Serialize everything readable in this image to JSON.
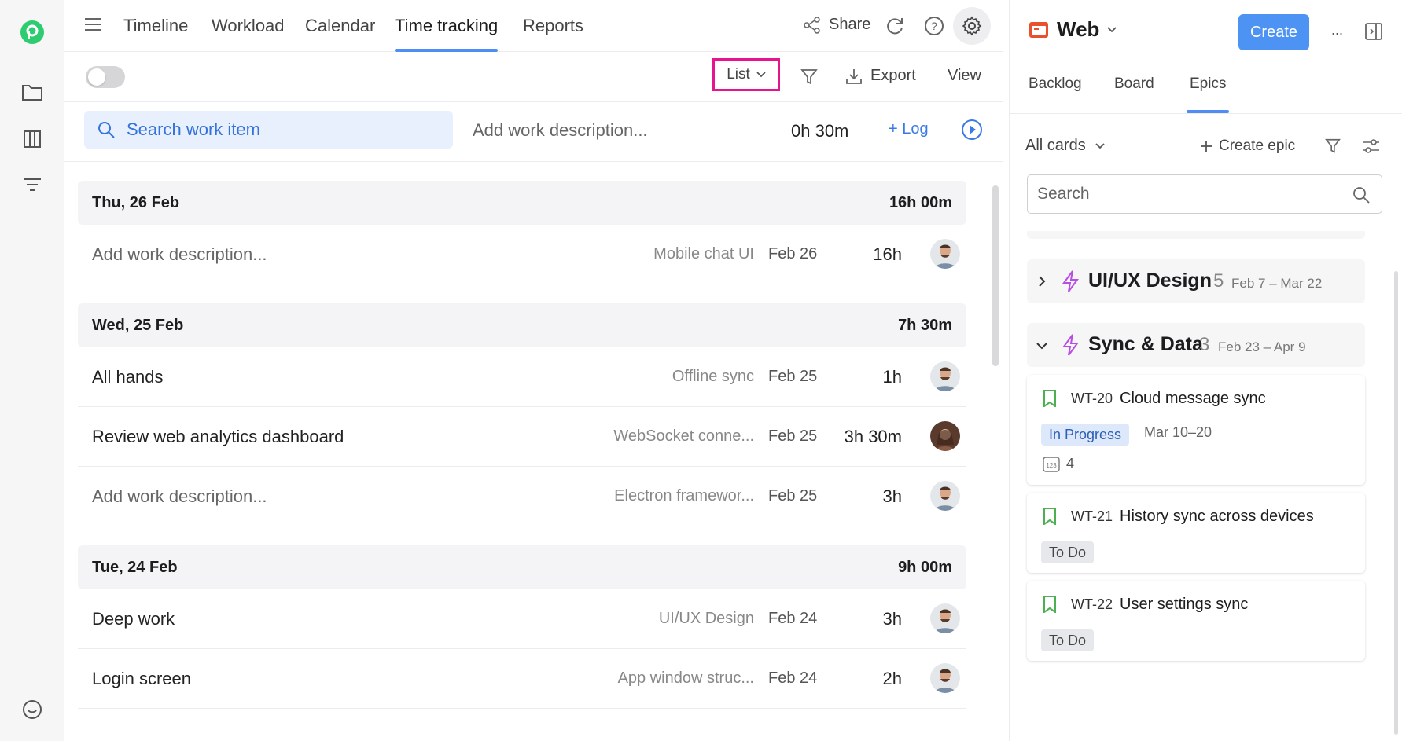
{
  "nav": {
    "tabs": [
      {
        "label": "Timeline"
      },
      {
        "label": "Workload"
      },
      {
        "label": "Calendar"
      },
      {
        "label": "Time tracking"
      },
      {
        "label": "Reports"
      }
    ],
    "share_label": "Share"
  },
  "toolbar": {
    "view_mode": "List",
    "export_label": "Export",
    "view_label": "View"
  },
  "timer": {
    "search_placeholder": "Search work item",
    "description_placeholder": "Add work description...",
    "duration": "0h 30m",
    "log_label": "+ Log"
  },
  "days": [
    {
      "date": "Thu, 26 Feb",
      "total": "16h 00m",
      "entries": [
        {
          "title": "Add work description...",
          "placeholder": true,
          "epic": "Mobile chat UI",
          "date": "Feb 26",
          "hours": "16h",
          "avatar": "man"
        }
      ]
    },
    {
      "date": "Wed, 25 Feb",
      "total": "7h 30m",
      "entries": [
        {
          "title": "All hands",
          "placeholder": false,
          "epic": "Offline sync",
          "date": "Feb 25",
          "hours": "1h",
          "avatar": "man"
        },
        {
          "title": "Review web analytics dashboard",
          "placeholder": false,
          "epic": "WebSocket conne...",
          "date": "Feb 25",
          "hours": "3h 30m",
          "avatar": "woman"
        },
        {
          "title": "Add work description...",
          "placeholder": true,
          "epic": "Electron framewor...",
          "date": "Feb 25",
          "hours": "3h",
          "avatar": "man"
        }
      ]
    },
    {
      "date": "Tue, 24 Feb",
      "total": "9h 00m",
      "entries": [
        {
          "title": "Deep work",
          "placeholder": false,
          "epic": "UI/UX Design",
          "date": "Feb 24",
          "hours": "3h",
          "avatar": "man"
        },
        {
          "title": "Login screen",
          "placeholder": false,
          "epic": "App window struc...",
          "date": "Feb 24",
          "hours": "2h",
          "avatar": "man"
        }
      ]
    }
  ],
  "panel": {
    "project": "Web",
    "create_label": "Create",
    "more_label": "...",
    "tabs": [
      {
        "label": "Backlog"
      },
      {
        "label": "Board"
      },
      {
        "label": "Epics"
      }
    ],
    "filter_label": "All cards",
    "create_epic_label": "Create epic",
    "search_placeholder": "Search",
    "epics": [
      {
        "name": "UI/UX Design",
        "count": "5",
        "range": "Feb 7 – Mar 22",
        "expanded": false
      },
      {
        "name": "Sync & Data",
        "count": "3",
        "range": "Feb 23 – Apr 9",
        "expanded": true
      }
    ],
    "cards": [
      {
        "id": "WT-20",
        "title": "Cloud message sync",
        "status": "In Progress",
        "dates": "Mar 10–20",
        "points": "4"
      },
      {
        "id": "WT-21",
        "title": "History sync across devices",
        "status": "To Do"
      },
      {
        "id": "WT-22",
        "title": "User settings sync",
        "status": "To Do"
      }
    ]
  },
  "colors": {
    "accent": "#4d8df5",
    "highlight": "#e6158d",
    "epic_icon": "#b84de6",
    "bookmark": "#4caf50",
    "in_progress_bg": "#dde9fb",
    "todo_bg": "#e6e8ec"
  }
}
